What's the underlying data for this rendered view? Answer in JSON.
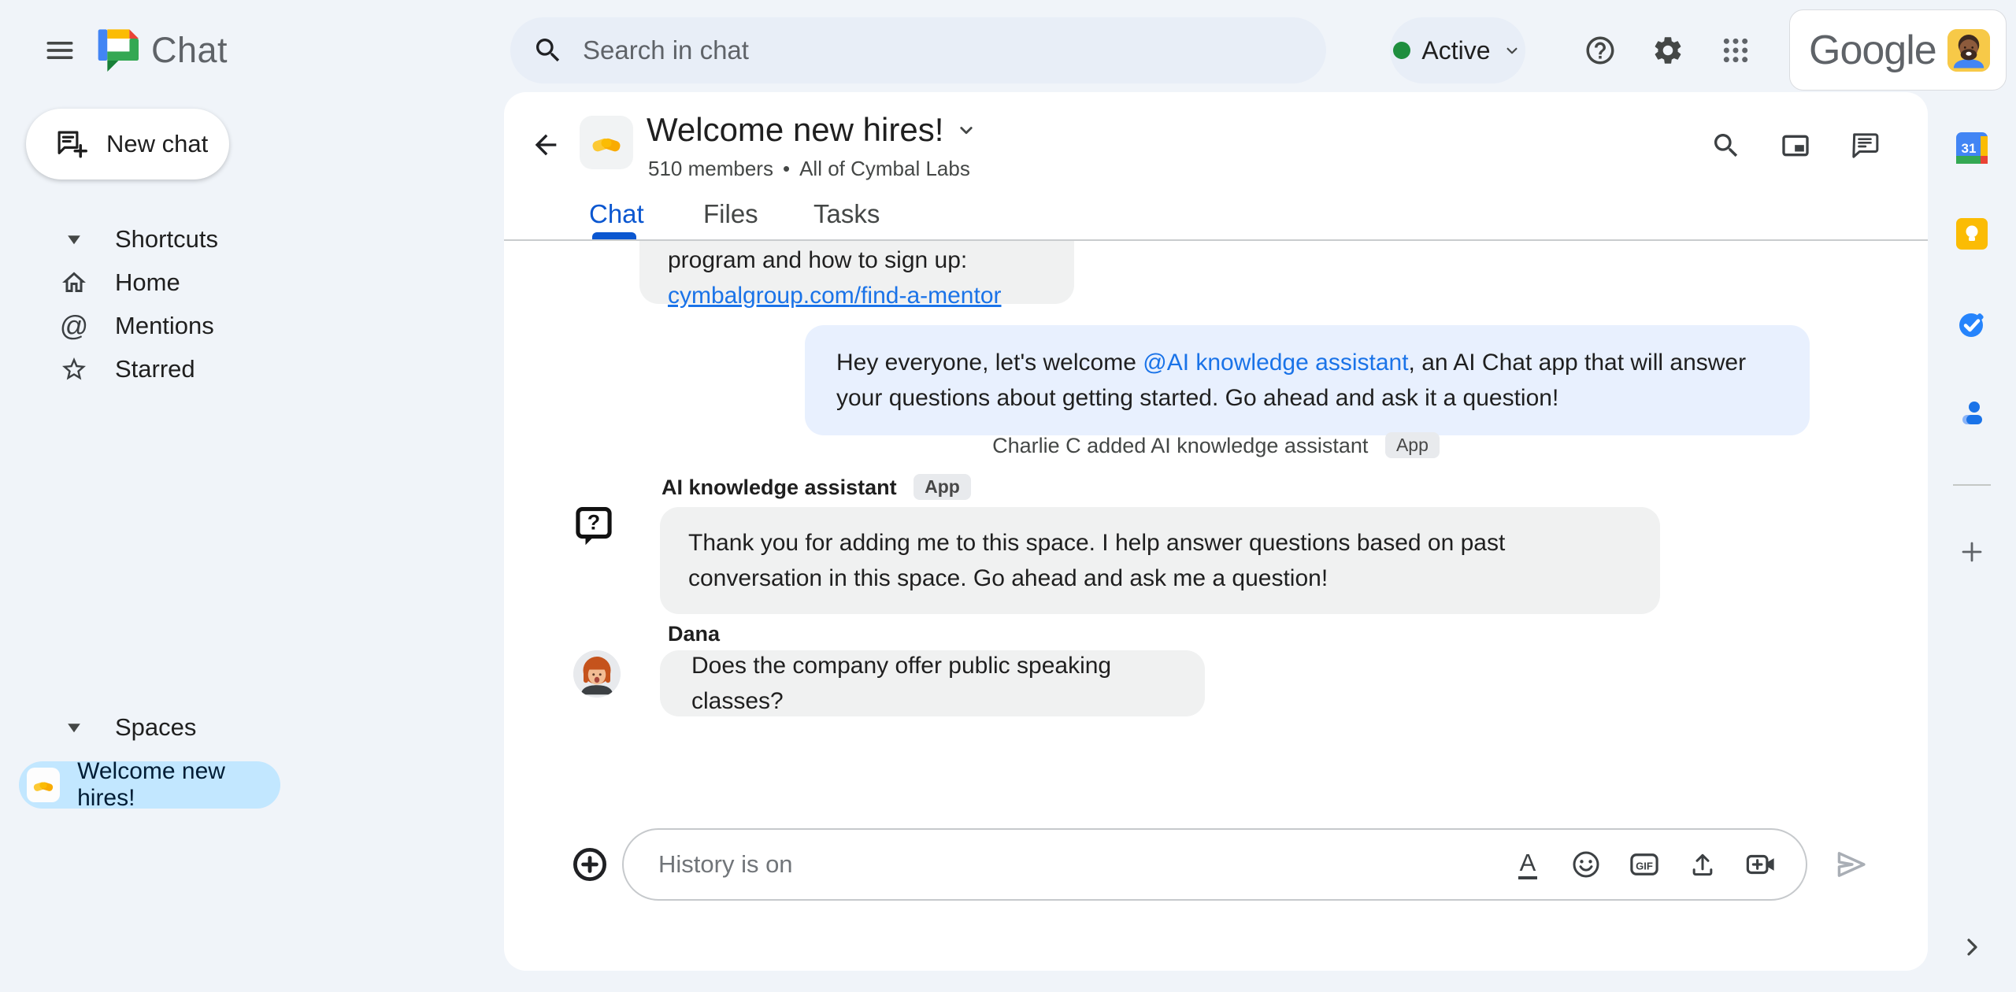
{
  "header": {
    "product": "Chat",
    "search": {
      "placeholder": "Search in chat"
    },
    "status": {
      "label": "Active"
    },
    "account": {
      "brand": "Google"
    }
  },
  "sidebar": {
    "new_chat": "New chat",
    "sections": [
      {
        "label": "Shortcuts",
        "items": [
          {
            "label": "Home"
          },
          {
            "label": "Mentions"
          },
          {
            "label": "Starred"
          }
        ]
      },
      {
        "label": "Spaces",
        "items": [
          {
            "label": "Welcome new hires!"
          }
        ]
      }
    ]
  },
  "space": {
    "title": "Welcome new hires!",
    "members": "510 members",
    "dot": "•",
    "org": "All of Cymbal Labs",
    "tabs": [
      {
        "label": "Chat"
      },
      {
        "label": "Files"
      },
      {
        "label": "Tasks"
      }
    ]
  },
  "messages": {
    "mentor": {
      "line": "program and how to sign up:",
      "link": "cymbalgroup.com/find-a-mentor"
    },
    "welcome": {
      "pre": "Hey everyone, let's welcome ",
      "mention": "@AI knowledge assistant",
      "post": ", an AI Chat app that will answer your questions about getting started.  Go ahead and ask it a question!"
    },
    "system": {
      "text": "Charlie C added AI knowledge assistant",
      "badge": "App"
    },
    "assistant": {
      "sender": "AI knowledge assistant",
      "badge": "App",
      "text": "Thank you for adding me to this space. I help answer questions based on past conversation in this space. Go ahead and ask me a question!"
    },
    "dana": {
      "sender": "Dana",
      "text": "Does the company offer public speaking classes?"
    }
  },
  "compose": {
    "placeholder": "History is on",
    "gif": "GIF"
  },
  "right_rail": {
    "calendar_day": "31"
  },
  "colors": {
    "background": "#F0F4F9",
    "surface": "#FFFFFF",
    "accent_blue": "#0B57D0",
    "link_blue": "#1A73E8",
    "selected_item_bg": "#C2E7FF",
    "bubble_gray": "#F0F1F1",
    "bubble_blue": "#E8F0FE",
    "active_green": "#1E8E3E"
  }
}
